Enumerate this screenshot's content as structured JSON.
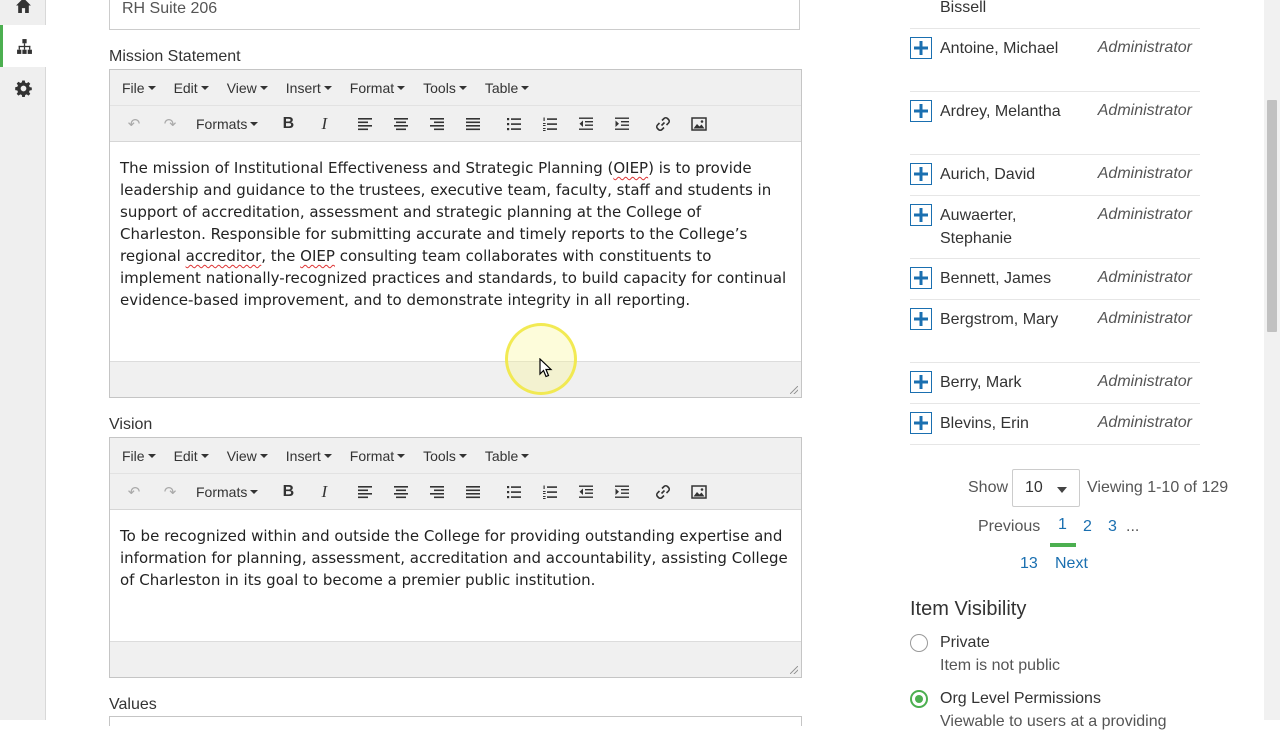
{
  "rail": {
    "icons": [
      "home-icon",
      "org-chart-icon",
      "gear-icon"
    ]
  },
  "address": {
    "value": "RH Suite 206"
  },
  "editor_menus": [
    "File",
    "Edit",
    "View",
    "Insert",
    "Format",
    "Tools",
    "Table"
  ],
  "formats_label": "Formats",
  "mission": {
    "label": "Mission Statement",
    "text_parts": [
      "The mission of Institutional Effectiveness and Strategic Planning (",
      "OIEP",
      ") is to provide leadership and guidance to the trustees, executive team, faculty, staff and students in support of accreditation, assessment and strategic planning at the College of Charleston. Responsible for submitting accurate and timely reports to the College’s regional ",
      "accreditor",
      ", the ",
      "OIEP",
      " consulting team collaborates with constituents to implement nationally-recognized practices and standards, to build capacity for continual evidence-based improvement, and to demonstrate integrity in all reporting."
    ]
  },
  "vision": {
    "label": "Vision",
    "text": "To be recognized within and outside the College for providing outstanding expertise and information for planning, assessment, accreditation and accountability, assisting College of Charleston in its goal to become a premier public institution."
  },
  "values": {
    "label": "Values"
  },
  "users": [
    {
      "name": "Bissell",
      "role": ""
    },
    {
      "name": "Antoine, Michael",
      "role": "Administrator"
    },
    {
      "name": "Ardrey, Melantha",
      "role": "Administrator"
    },
    {
      "name": "Aurich, David",
      "role": "Administrator"
    },
    {
      "name": "Auwaerter, Stephanie",
      "role": "Administrator"
    },
    {
      "name": "Bennett, James",
      "role": "Administrator"
    },
    {
      "name": "Bergstrom, Mary",
      "role": "Administrator"
    },
    {
      "name": "Berry, Mark",
      "role": "Administrator"
    },
    {
      "name": "Blevins, Erin",
      "role": "Administrator"
    }
  ],
  "pager": {
    "show_label": "Show",
    "page_size": "10",
    "viewing": "Viewing 1-10 of 129",
    "previous": "Previous",
    "pages": [
      "1",
      "2",
      "3"
    ],
    "ellipsis": "...",
    "last_page": "13",
    "next": "Next"
  },
  "visibility": {
    "title": "Item Visibility",
    "options": [
      {
        "label": "Private",
        "desc": "Item is not public",
        "selected": false
      },
      {
        "label": "Org Level Permissions",
        "desc": "Viewable to users at a providing",
        "selected": true
      }
    ]
  },
  "colors": {
    "accent_green": "#4caf50",
    "link_blue": "#1a6fb0"
  }
}
